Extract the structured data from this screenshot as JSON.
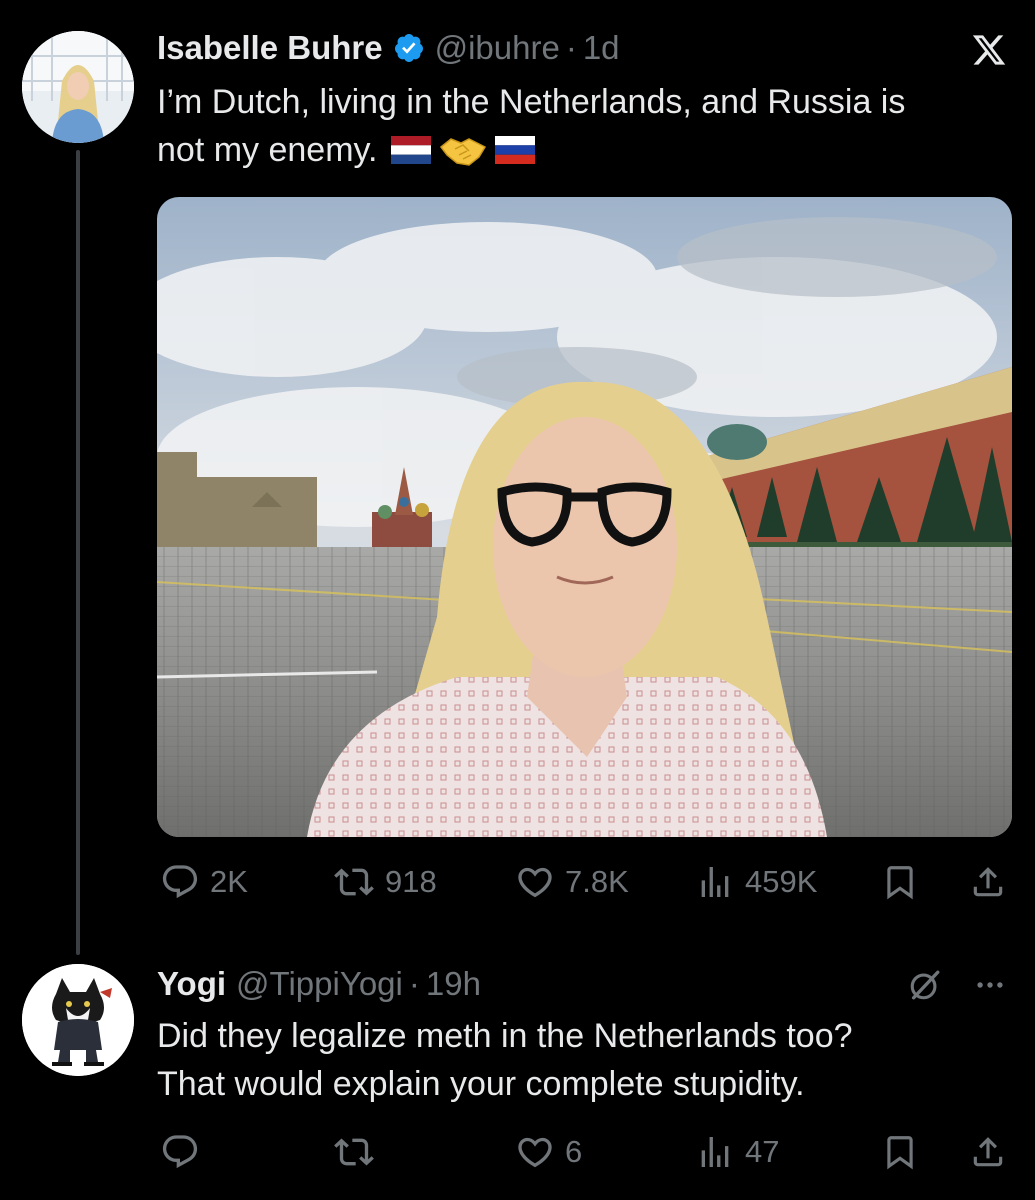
{
  "tweet": {
    "author_name": "Isabelle Buhre",
    "verified": true,
    "handle": "@ibuhre",
    "separator": "·",
    "time": "1d",
    "text_line1": "I’m Dutch, living in the Netherlands, and Russia is",
    "text_line2": "not my enemy.",
    "emojis": [
      "netherlands-flag-emoji",
      "handshake-emoji",
      "russia-flag-emoji"
    ],
    "metrics": {
      "replies": "2K",
      "reposts": "918",
      "likes": "7.8K",
      "views": "459K"
    }
  },
  "reply": {
    "author_name": "Yogi",
    "handle": "@TippiYogi",
    "separator": "·",
    "time": "19h",
    "text_line1": "Did they legalize meth in the Netherlands too?",
    "text_line2": "That would explain your complete stupidity.",
    "metrics": {
      "replies": "",
      "reposts": "",
      "likes": "6",
      "views": "47"
    }
  },
  "colors": {
    "background": "#000000",
    "text_primary": "#e7e9ea",
    "text_secondary": "#71767b",
    "verified_blue": "#1d9bf0",
    "thread_line": "#3b3f43"
  },
  "icons": [
    "x-logo-icon",
    "verified-badge-icon",
    "reply-icon",
    "repost-icon",
    "like-icon",
    "views-icon",
    "bookmark-icon",
    "share-icon",
    "grok-icon",
    "more-icon"
  ]
}
